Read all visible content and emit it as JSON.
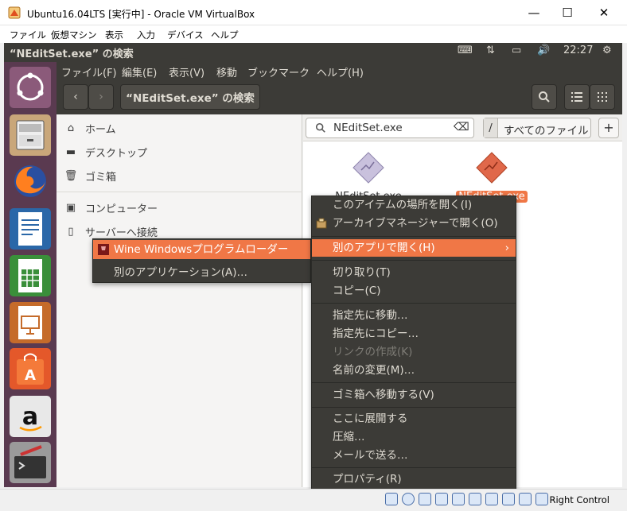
{
  "host_window": {
    "title": "Ubuntu16.04LTS [実行中] - Oracle VM VirtualBox",
    "menu": [
      "ファイル",
      "仮想マシン",
      "表示",
      "入力",
      "デバイス",
      "ヘルプ"
    ],
    "minimize": "—",
    "maximize": "☐",
    "close": "✕"
  },
  "ubuntu_panel": {
    "window_title": "“NEditSet.exe” の検索",
    "keyboard_icon": "⌨",
    "network_icon": "⇅",
    "battery_icon": "▭",
    "volume_icon": "🔊",
    "clock": "22:27",
    "settings_icon": "⚙"
  },
  "launcher": {
    "items": [
      "dash",
      "files",
      "firefox",
      "writer",
      "calc",
      "impress",
      "software-center",
      "amazon",
      "system-settings"
    ],
    "amazon_letter": "a",
    "software_letter": "A"
  },
  "nautilus": {
    "menu": [
      "ファイル(F)",
      "編集(E)",
      "表示(V)",
      "移動",
      "ブックマーク",
      "ヘルプ(H)"
    ],
    "back": "‹",
    "forward": "›",
    "location": "“NEditSet.exe” の検索",
    "search_icon": "🔍",
    "list_icon": "☰",
    "grid_icon": "⋮⋮",
    "sidebar": [
      {
        "icon": "⌂",
        "label": "ホーム"
      },
      {
        "icon": "▬",
        "label": "デスクトップ"
      },
      {
        "icon": "🗑",
        "label": "ゴミ箱"
      },
      {
        "icon": "▣",
        "label": "コンピューター"
      },
      {
        "icon": "▯",
        "label": "サーバーへ接続"
      }
    ],
    "search": {
      "query": "NEditSet.exe",
      "clear_icon": "⌫",
      "scope_slash": "/",
      "scope": "すべてのファイル",
      "add": "+"
    },
    "files": [
      {
        "name": "NEditSet.exe",
        "selected": false
      },
      {
        "name": "NEditSet.exe",
        "selected": true
      }
    ]
  },
  "context_menu": {
    "items": [
      {
        "label": "このアイテムの場所を開く(I)"
      },
      {
        "label": "アーカイブマネージャーで開く(O)"
      },
      {
        "label": "別のアプリで開く(H)",
        "arrow": "›"
      },
      {
        "label": "切り取り(T)"
      },
      {
        "label": "コピー(C)"
      },
      {
        "label": "指定先に移動…"
      },
      {
        "label": "指定先にコピー…"
      },
      {
        "label": "リンクの作成(K)"
      },
      {
        "label": "名前の変更(M)…"
      },
      {
        "label": "ゴミ箱へ移動する(V)"
      },
      {
        "label": "ここに展開する"
      },
      {
        "label": "圧縮…"
      },
      {
        "label": "メールで送る…"
      },
      {
        "label": "プロパティ(R)"
      }
    ]
  },
  "submenu": {
    "items": [
      {
        "label": "Wine Windowsプログラムローダー"
      },
      {
        "label": "別のアプリケーション(A)…"
      }
    ]
  },
  "vbox_status": {
    "host_key": "Right Control"
  },
  "colors": {
    "ubuntu_dark": "#3c3b37",
    "ubuntu_orange": "#f07746",
    "launcher_bg": "#5a3a50"
  }
}
